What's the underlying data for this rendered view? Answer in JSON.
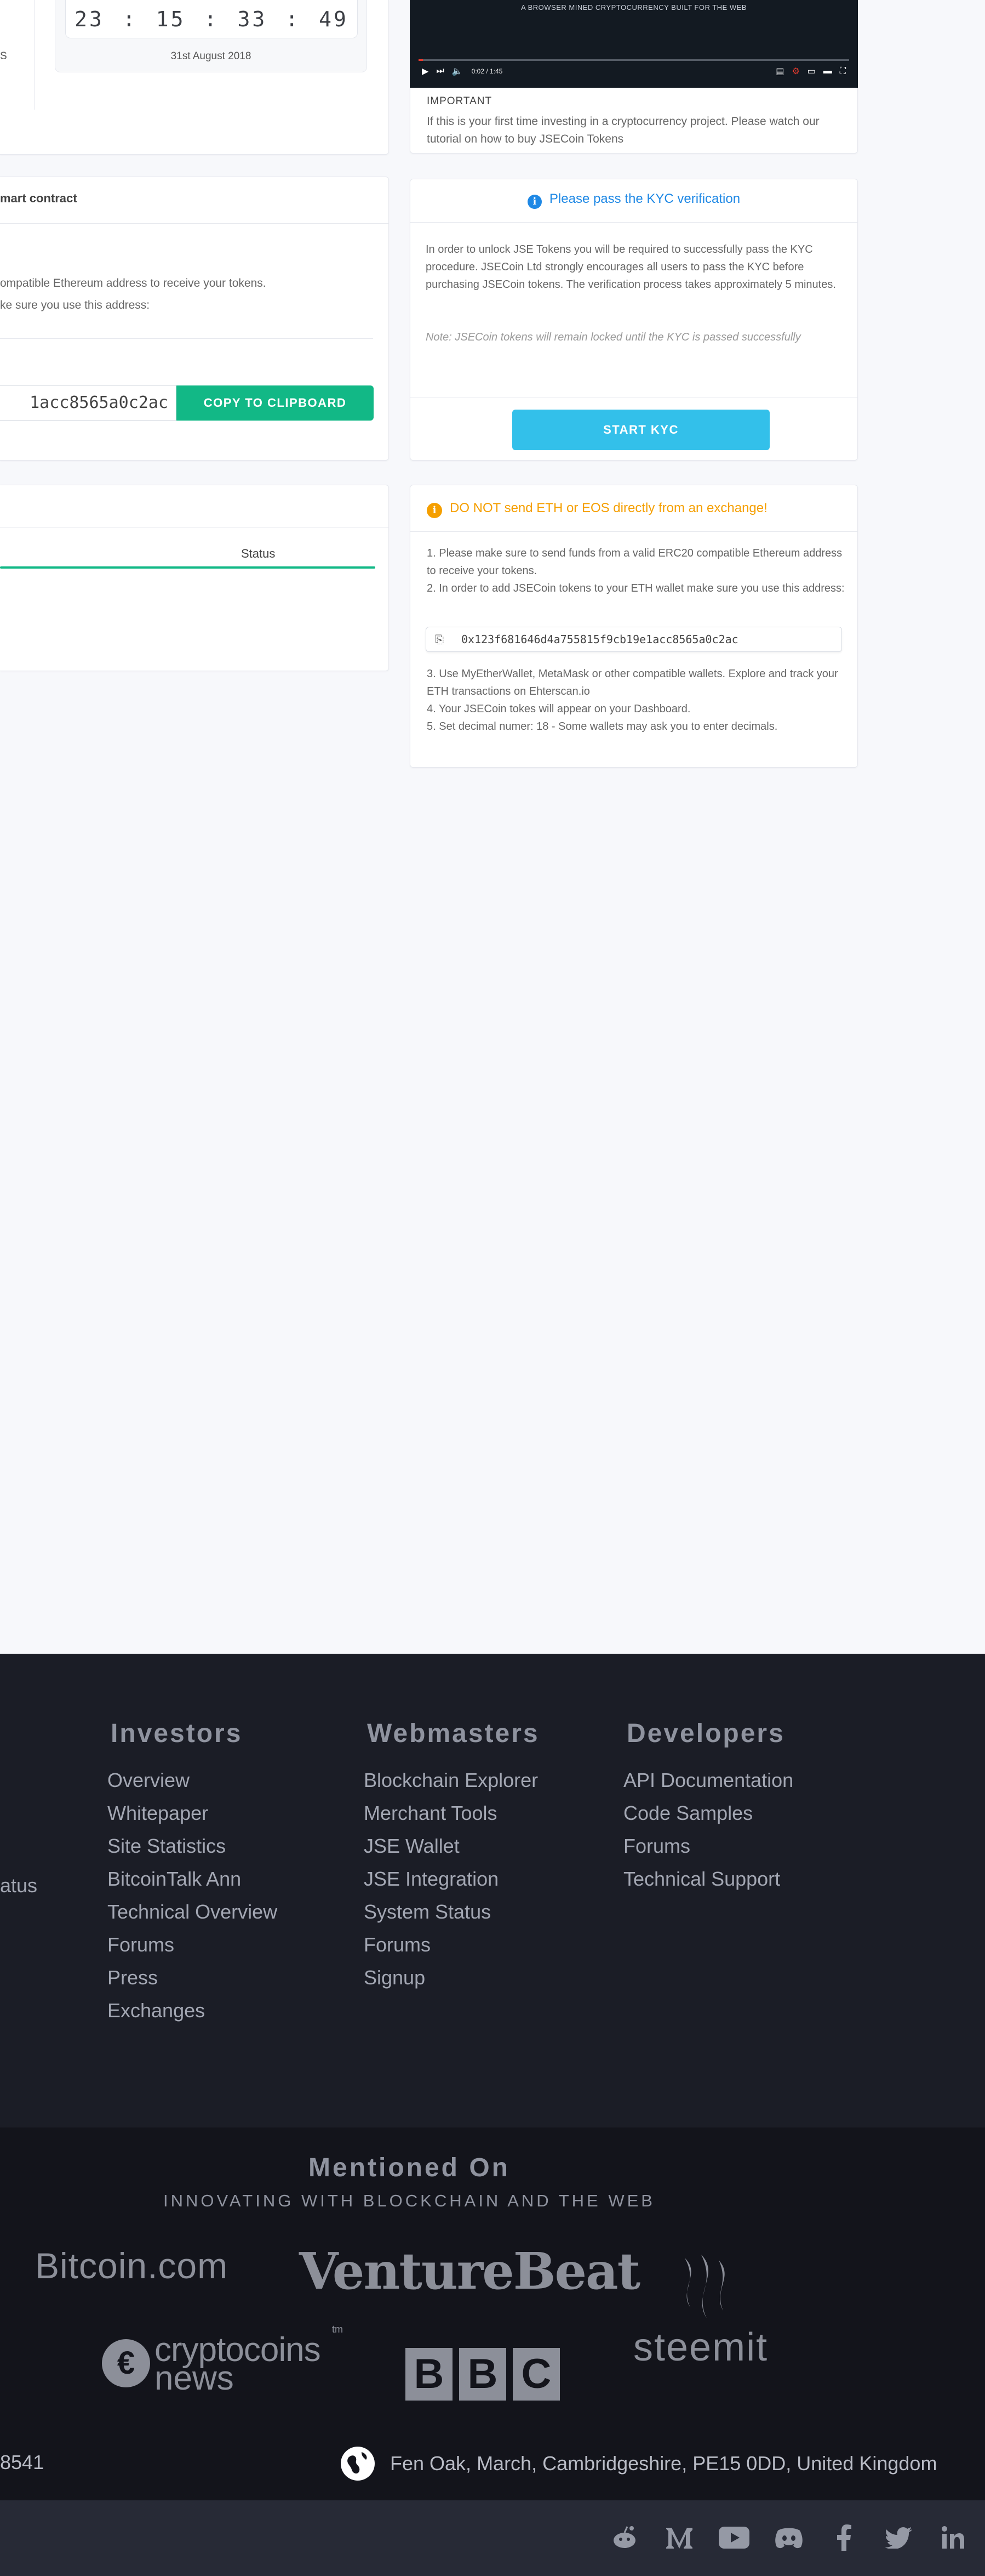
{
  "countdown": {
    "hours": "23",
    "minutes": "15",
    "seconds": "33",
    "centis": "49",
    "separator": ":",
    "date": "31st August 2018",
    "left_fragment": "S"
  },
  "video": {
    "caption": "A BROWSER MINED CRYPTOCURRENCY BUILT FOR THE WEB",
    "time": "0:02 / 1:45",
    "play_icon": "play-icon",
    "next_icon": "next-icon",
    "volume_icon": "volume-icon"
  },
  "important": {
    "title": "IMPORTANT",
    "text": "If this is your first time investing in a cryptocurrency project. Please watch our tutorial on how to buy JSECoin Tokens"
  },
  "smart_contract": {
    "title": "mart contract",
    "text_line1": "ompatible Ethereum address to receive your tokens.",
    "text_line2": "ke sure you use this address:",
    "address_fragment": "1acc8565a0c2ac",
    "copy_button": "COPY TO CLIPBOARD"
  },
  "kyc": {
    "title": "Please pass the KYC verification",
    "text": "In order to unlock JSE Tokens you will be required to successfully pass the KYC procedure. JSECoin Ltd strongly encourages all users to pass the KYC before purchasing JSECoin tokens. The verification process takes approximately 5 minutes.",
    "note": "Note: JSECoin tokens will remain locked until the KYC is passed successfully",
    "button": "START KYC"
  },
  "status_tab": {
    "label": "Status"
  },
  "warning": {
    "title": "DO NOT send ETH or EOS directly from an exchange!",
    "step1": "1. Please make sure to send funds from a valid ERC20 compatible Ethereum address to receive your tokens.",
    "step2": "2. In order to add JSECoin tokens to your ETH wallet make sure you use this address:",
    "address": "0x123f681646d4a755815f9cb19e1acc8565a0c2ac",
    "step3": "3. Use MyEtherWallet, MetaMask or other compatible wallets. Explore and track your ETH transactions on Ehterscan.io",
    "step4": "4. Your JSECoin tokes will appear on your Dashboard.",
    "step5": "5. Set decimal numer: 18 - Some wallets may ask you to enter decimals."
  },
  "footer": {
    "left_fragment": "atus",
    "investors": {
      "heading": "Investors",
      "links": [
        "Overview",
        "Whitepaper",
        "Site Statistics",
        "BitcoinTalk Ann",
        "Technical Overview",
        "Forums",
        "Press",
        "Exchanges"
      ]
    },
    "webmasters": {
      "heading": "Webmasters",
      "links": [
        "Blockchain Explorer",
        "Merchant Tools",
        "JSE Wallet",
        "JSE Integration",
        "System Status",
        "Forums",
        "Signup"
      ]
    },
    "developers": {
      "heading": "Developers",
      "links": [
        "API Documentation",
        "Code Samples",
        "Forums",
        "Technical Support"
      ]
    }
  },
  "mentions": {
    "title": "Mentioned On",
    "subtitle": "INNOVATING WITH BLOCKCHAIN AND THE WEB",
    "logos": {
      "bitcoin": "Bitcoin.com",
      "venturebeat": "VentureBeat",
      "steemit": "steemit",
      "cryptocoins_top": "cryptocoins",
      "cryptocoins_bottom": "news",
      "cryptocoins_tm": "tm",
      "bbc": [
        "B",
        "B",
        "C"
      ]
    }
  },
  "contact": {
    "phone_fragment": "8541",
    "address": "Fen Oak, March, Cambridgeshire, PE15 0DD, United Kingdom"
  },
  "social": [
    "reddit-icon",
    "medium-icon",
    "youtube-icon",
    "discord-icon",
    "facebook-icon",
    "twitter-icon",
    "linkedin-icon"
  ]
}
